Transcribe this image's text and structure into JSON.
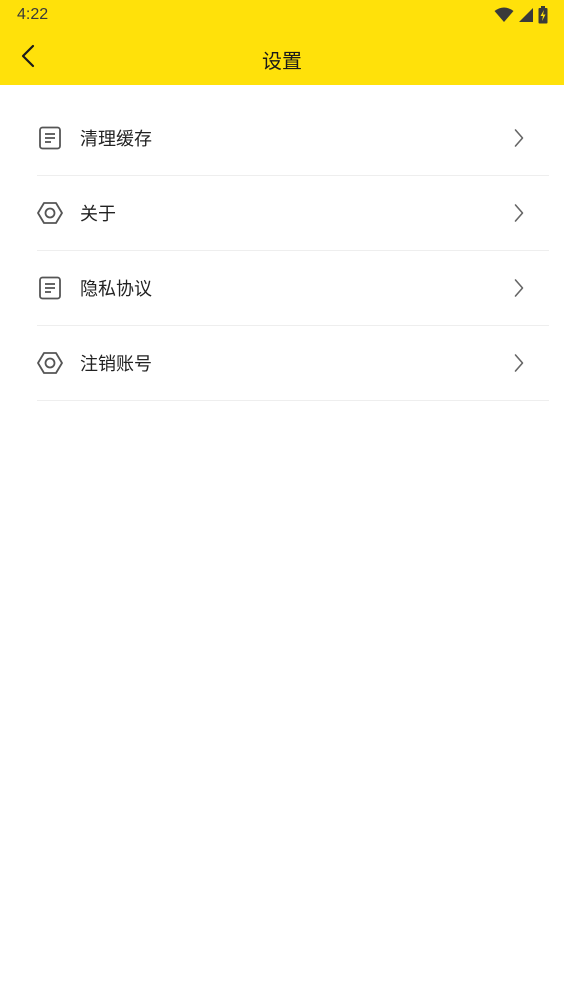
{
  "status_bar": {
    "time": "4:22",
    "icons": [
      "wifi-icon",
      "signal-icon",
      "battery-charging-icon"
    ]
  },
  "header": {
    "title": "设置",
    "back_icon": "chevron-left-icon",
    "background_color": "#FFE10A"
  },
  "menu": {
    "items": [
      {
        "label": "清理缓存",
        "icon": "document-icon"
      },
      {
        "label": "关于",
        "icon": "hexagon-nut-icon"
      },
      {
        "label": "隐私协议",
        "icon": "document-icon"
      },
      {
        "label": "注销账号",
        "icon": "hexagon-nut-icon"
      }
    ],
    "arrow_icon": "chevron-right-icon"
  }
}
